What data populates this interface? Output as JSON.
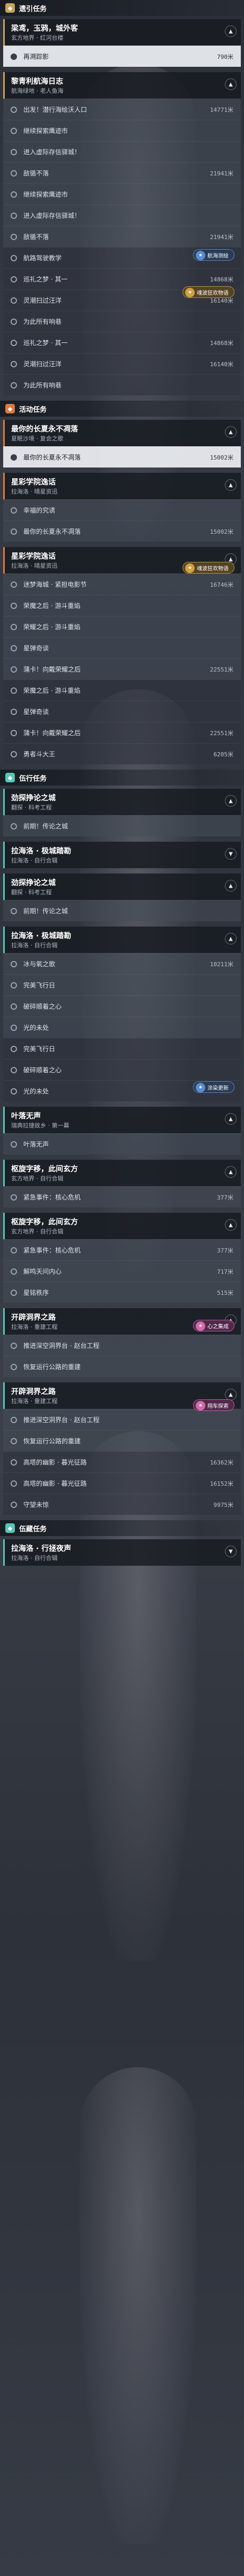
{
  "sections": {
    "story": "遗引任务",
    "event": "活动任务",
    "side": "伍行任务",
    "special": "伍藏任务"
  },
  "colors": {
    "story": "#c8a25a",
    "event": "#e07a3a",
    "side": "#58c6b8",
    "special": "#58c6b8"
  },
  "q1": {
    "title": "梁鸢，玉鸦，城外客",
    "sub": "玄方地界 · 红河台楼",
    "steps": [
      {
        "label": "再溯踪影",
        "dist": "790米"
      }
    ]
  },
  "q2": {
    "title": "黎青利航海日志",
    "sub": "航海绿地 · 老人鱼海",
    "steps": [
      {
        "label": "出发！潜行海绘沃人口",
        "dist": "14771米"
      },
      {
        "label": "继续探索鹰迹市",
        "dist": ""
      },
      {
        "label": "进入虚际存信驿城！",
        "dist": ""
      },
      {
        "label": "敌循不落",
        "dist": "21941米"
      },
      {
        "label": "继续探索鹰迹市",
        "dist": ""
      },
      {
        "label": "进入虚际存信驿城！",
        "dist": ""
      },
      {
        "label": "敌循不落",
        "dist": "21941米"
      },
      {
        "label": "航路驾驶教学",
        "dist": ""
      },
      {
        "label": "巡礼之梦 · 其一",
        "dist": "14868米"
      },
      {
        "label": "灵潮扫过汪洋",
        "dist": "16140米"
      },
      {
        "label": "为此所有响巷",
        "dist": ""
      },
      {
        "label": "巡礼之梦 · 其一",
        "dist": "14868米"
      },
      {
        "label": "灵潮扫过汪洋",
        "dist": "16140米"
      },
      {
        "label": "为此所有响巷",
        "dist": ""
      }
    ]
  },
  "tags": {
    "nav": "航海测绘",
    "story": "魂波狂欢物语",
    "event": "涂染更新",
    "badge": "心之集成",
    "ram": "翔车探索"
  },
  "e1": {
    "title": "最你的长夏永不凋落",
    "sub": "夏眠沙境 · 复会之歌",
    "steps": [
      {
        "label": "最你的长夏永不凋落",
        "dist": "15002米"
      }
    ]
  },
  "e2": {
    "title": "星彩学院逸话",
    "sub": "拉海洛 · 晴星资迅",
    "steps": [
      {
        "label": "幸福的究诱",
        "dist": ""
      },
      {
        "label": "最你的长夏永不凋落",
        "dist": "15002米"
      }
    ]
  },
  "e3": {
    "title": "星彩学院逸话",
    "sub": "拉海洛 · 晴星资迅",
    "steps": [
      {
        "label": "迷梦海城 · 紧担电影节",
        "dist": "16746米"
      },
      {
        "label": "荣魔之后 · 游斗重焰",
        "dist": ""
      },
      {
        "label": "荣耀之后 · 游斗重焰",
        "dist": ""
      },
      {
        "label": "星弹奇谈",
        "dist": ""
      },
      {
        "label": "蒲卡！向戴荣耀之后",
        "dist": "22551米"
      },
      {
        "label": "荣魔之后 · 游斗重焰",
        "dist": ""
      },
      {
        "label": "星弹奇谈",
        "dist": ""
      },
      {
        "label": "蒲卡！向戴荣耀之后",
        "dist": "22551米"
      },
      {
        "label": "勇者斗大王",
        "dist": "6205米"
      }
    ]
  },
  "s1": {
    "title": "劲探挣论之城",
    "sub": "翻探 · 科考工程",
    "steps": [
      {
        "label": "前期！传论之城",
        "dist": ""
      }
    ]
  },
  "s2": {
    "title": "拉海洛 · 极城踏勘",
    "sub": "拉海洛 · 自行合辑",
    "steps": []
  },
  "s3": {
    "title": "劲探挣论之城",
    "sub": "翻探 · 科考工程",
    "steps": [
      {
        "label": "前期！传论之城",
        "dist": ""
      }
    ]
  },
  "s4": {
    "title": "拉海洛 · 极城踏勘",
    "sub": "拉海洛 · 自行合辑",
    "steps": [
      {
        "label": "冰与氧之歌",
        "dist": "10211米"
      },
      {
        "label": "完美飞行日",
        "dist": ""
      },
      {
        "label": "破碎顺着之心",
        "dist": ""
      },
      {
        "label": "光的未处",
        "dist": ""
      },
      {
        "label": "完美飞行日",
        "dist": ""
      },
      {
        "label": "破碎顺着之心",
        "dist": ""
      },
      {
        "label": "光的未处",
        "dist": ""
      }
    ]
  },
  "s5": {
    "title": "叶落无声",
    "sub": "瑞典拉捷故乡 · 第一幕",
    "steps": [
      {
        "label": "叶落无声",
        "dist": ""
      }
    ]
  },
  "s6": {
    "title": "枢旋字移，此间玄方",
    "sub": "玄方地界 · 自行合辑",
    "steps": [
      {
        "label": "紧急事件：核心危机",
        "dist": "377米"
      }
    ]
  },
  "s7": {
    "title": "枢旋字移，此间玄方",
    "sub": "玄方地界 · 自行合辑",
    "steps": [
      {
        "label": "紧急事件：核心危机",
        "dist": "377米"
      },
      {
        "label": "解鸣天问内心",
        "dist": "717米"
      },
      {
        "label": "星铭秩序",
        "dist": "515米"
      }
    ]
  },
  "s8": {
    "title": "开辟洞界之路",
    "sub": "拉海洛 · 重建工程",
    "steps": [
      {
        "label": "推进深空洞界台 · 赵台工程",
        "dist": ""
      },
      {
        "label": "恢复运行公路的重建",
        "dist": ""
      }
    ]
  },
  "s9": {
    "title": "开辟洞界之路",
    "sub": "拉海洛 · 重建工程",
    "steps": [
      {
        "label": "推进深空洞界台 · 赵台工程",
        "dist": ""
      },
      {
        "label": "恢复运行公路的重建",
        "dist": ""
      },
      {
        "label": "高塔的幽影 · 暮光征路",
        "dist": "16362米"
      },
      {
        "label": "高塔的幽影 · 暮光征路",
        "dist": "16152米"
      },
      {
        "label": "守望未惊",
        "dist": "9975米"
      }
    ]
  },
  "sp1": {
    "title": "拉海洛 · 行拯夜声",
    "sub": "拉海洛 · 自行合辑"
  }
}
